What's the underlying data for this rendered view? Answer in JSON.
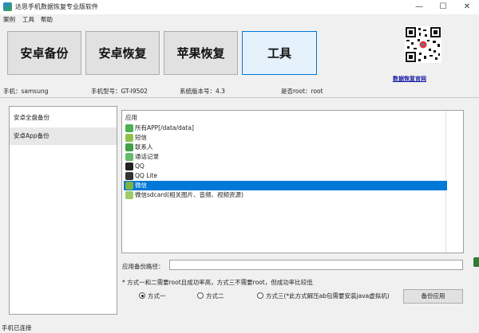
{
  "window": {
    "title": "达思手机数据恢复专业版软件",
    "controls": [
      "—",
      "☐",
      "✕"
    ]
  },
  "menu": [
    "案例",
    "工具",
    "帮助"
  ],
  "toolbar": {
    "buttons": [
      {
        "label": "安卓备份",
        "active": false
      },
      {
        "label": "安卓恢复",
        "active": false
      },
      {
        "label": "苹果恢复",
        "active": false
      },
      {
        "label": "工具",
        "active": true
      }
    ]
  },
  "promo": {
    "link_text": "数据恢复官网",
    "qr_icon": "qr-code-icon"
  },
  "device_info": {
    "phone": "手机：samsung",
    "model": "手机型号：GT-I9502",
    "system": "系统版本号：4.3",
    "root": "是否root：root"
  },
  "nav": [
    {
      "label": "安卓全盘备份",
      "selected": false
    },
    {
      "label": "安卓App备份",
      "selected": true
    }
  ],
  "app_list": {
    "header": "应用",
    "rows": [
      {
        "label": "所有APP[/data/data]",
        "icon": "apps-icon",
        "color": "#4caf50",
        "selected": false
      },
      {
        "label": "短信",
        "icon": "sms-icon",
        "color": "#8bc34a",
        "selected": false
      },
      {
        "label": "联系人",
        "icon": "contacts-icon",
        "color": "#43a047",
        "selected": false
      },
      {
        "label": "通话记录",
        "icon": "call-log-icon",
        "color": "#66bb6a",
        "selected": false
      },
      {
        "label": "QQ",
        "icon": "qq-icon",
        "color": "#222222",
        "selected": false
      },
      {
        "label": "QQ Lite",
        "icon": "qq-lite-icon",
        "color": "#333333",
        "selected": false
      },
      {
        "label": "微信",
        "icon": "wechat-icon",
        "color": "#7cb342",
        "selected": true
      },
      {
        "label": "微信sdcard(相关图片、音频、视频资源)",
        "icon": "wechat-sdcard-icon",
        "color": "#9ccc65",
        "selected": false
      }
    ]
  },
  "backup_path": {
    "label": "应用备份路径：",
    "value": ""
  },
  "note": "* 方式一和二需要root且成功率高，方式三不需要root，但成功率比较低",
  "methods": [
    {
      "label": "方式一",
      "checked": true
    },
    {
      "label": "方式二",
      "checked": false
    },
    {
      "label": "方式三(*此方式解压ab包需要安装java虚拟机)",
      "checked": false
    }
  ],
  "backup_button": "备份应用",
  "status": "手机已连接",
  "colors": {
    "accent": "#0078d7",
    "link": "#1a1aa6"
  }
}
